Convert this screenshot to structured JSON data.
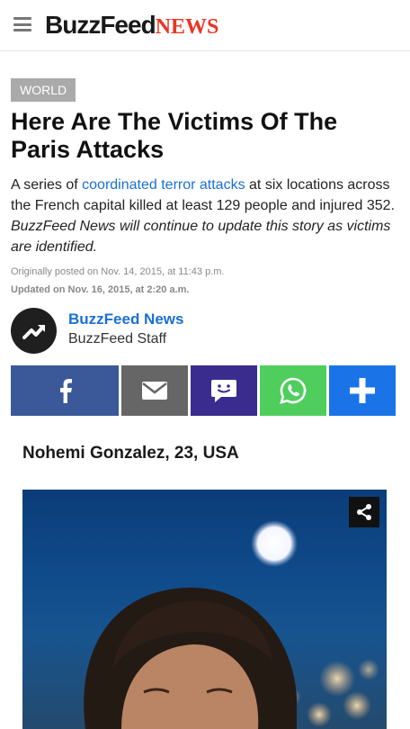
{
  "header": {
    "logo_buzz": "BuzzFeed",
    "logo_news": "NEWS"
  },
  "article": {
    "section_tag": "WORLD",
    "title": "Here Are The Victims Of The Paris Attacks",
    "lede_before_link": "A series of ",
    "lede_link": "coordinated terror attacks",
    "lede_after_link": " at six locations across the French capital killed at least 129 people and injured 352. ",
    "lede_italic": "BuzzFeed News will continue to update this story as victims are identified.",
    "posted": "Originally posted on Nov. 14, 2015, at 11:43 p.m.",
    "updated": "Updated on Nov. 16, 2015, at 2:20 a.m.",
    "author_name": "BuzzFeed News",
    "author_role": "BuzzFeed Staff"
  },
  "share_buttons": [
    {
      "icon": "facebook-icon",
      "color": "#3b5998"
    },
    {
      "icon": "email-icon",
      "color": "#666666"
    },
    {
      "icon": "sms-icon",
      "color": "#3a2c8f"
    },
    {
      "icon": "whatsapp-icon",
      "color": "#4fce5d"
    },
    {
      "icon": "plus-icon",
      "color": "#1a74e8"
    }
  ],
  "list_item": {
    "heading": "Nohemi Gonzalez, 23, USA",
    "photo_share_icon": "share-icon"
  }
}
